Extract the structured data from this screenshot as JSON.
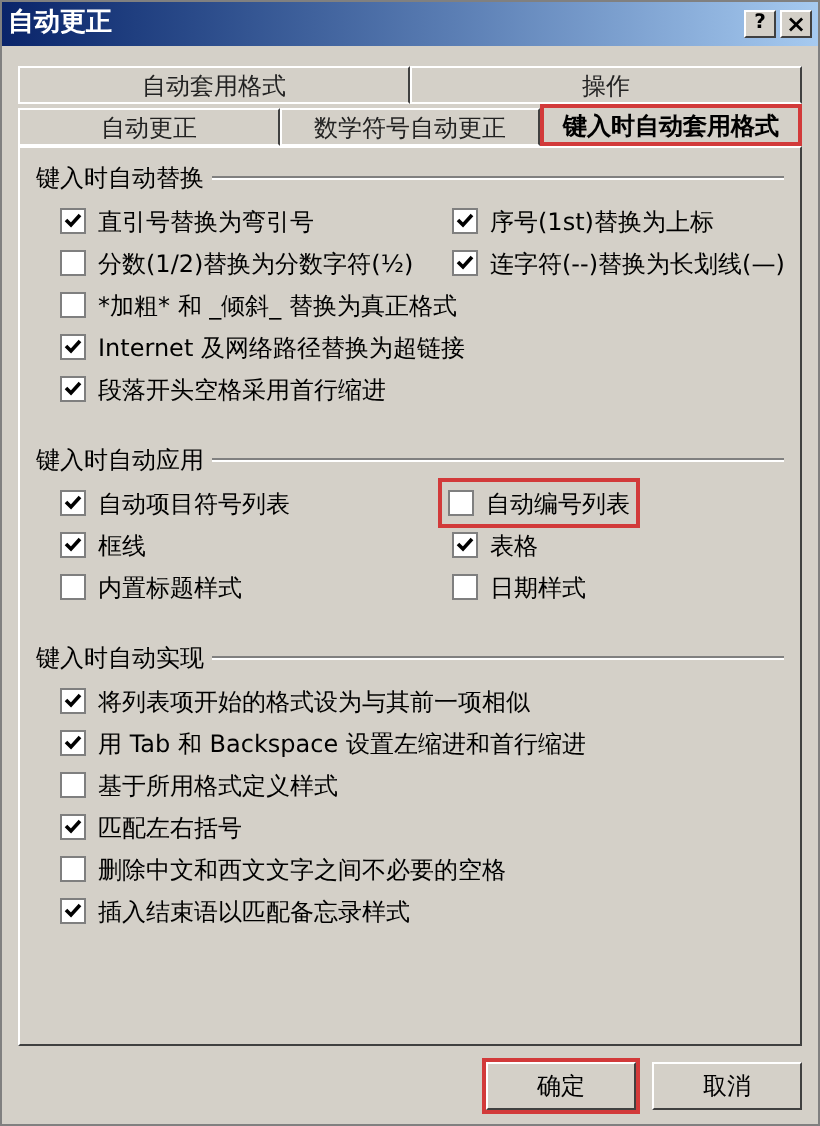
{
  "window": {
    "title": "自动更正",
    "help": "?",
    "close": "×"
  },
  "tab_rows": [
    [
      {
        "label": "自动套用格式",
        "selected": false,
        "highlighted": false
      },
      {
        "label": "操作",
        "selected": false,
        "highlighted": false
      }
    ],
    [
      {
        "label": "自动更正",
        "selected": false,
        "highlighted": false
      },
      {
        "label": "数学符号自动更正",
        "selected": false,
        "highlighted": false
      },
      {
        "label": "键入时自动套用格式",
        "selected": true,
        "highlighted": true
      }
    ]
  ],
  "sections": [
    {
      "title": "键入时自动替换",
      "left": [
        {
          "label": "直引号替换为弯引号",
          "checked": true,
          "highlighted": false
        },
        {
          "label": "分数(1/2)替换为分数字符(½)",
          "checked": false,
          "highlighted": false
        },
        {
          "label": "*加粗* 和 _倾斜_ 替换为真正格式",
          "checked": false,
          "highlighted": false
        },
        {
          "label": "Internet 及网络路径替换为超链接",
          "checked": true,
          "highlighted": false
        },
        {
          "label": "段落开头空格采用首行缩进",
          "checked": true,
          "highlighted": false
        }
      ],
      "right": [
        {
          "label": "序号(1st)替换为上标",
          "checked": true,
          "highlighted": false
        },
        {
          "label": "连字符(--)替换为长划线(—)",
          "checked": true,
          "highlighted": false
        }
      ]
    },
    {
      "title": "键入时自动应用",
      "left": [
        {
          "label": "自动项目符号列表",
          "checked": true,
          "highlighted": false
        },
        {
          "label": "框线",
          "checked": true,
          "highlighted": false
        },
        {
          "label": "内置标题样式",
          "checked": false,
          "highlighted": false
        }
      ],
      "right": [
        {
          "label": "自动编号列表",
          "checked": false,
          "highlighted": true
        },
        {
          "label": "表格",
          "checked": true,
          "highlighted": false
        },
        {
          "label": "日期样式",
          "checked": false,
          "highlighted": false
        }
      ]
    },
    {
      "title": "键入时自动实现",
      "left": [
        {
          "label": "将列表项开始的格式设为与其前一项相似",
          "checked": true,
          "highlighted": false
        },
        {
          "label": "用 Tab 和 Backspace 设置左缩进和首行缩进",
          "checked": true,
          "highlighted": false
        },
        {
          "label": "基于所用格式定义样式",
          "checked": false,
          "highlighted": false
        },
        {
          "label": "匹配左右括号",
          "checked": true,
          "highlighted": false
        },
        {
          "label": "删除中文和西文文字之间不必要的空格",
          "checked": false,
          "highlighted": false
        },
        {
          "label": "插入结束语以匹配备忘录样式",
          "checked": true,
          "highlighted": false
        }
      ]
    }
  ],
  "buttons": [
    {
      "label": "确定",
      "highlighted": true
    },
    {
      "label": "取消",
      "highlighted": false
    }
  ]
}
